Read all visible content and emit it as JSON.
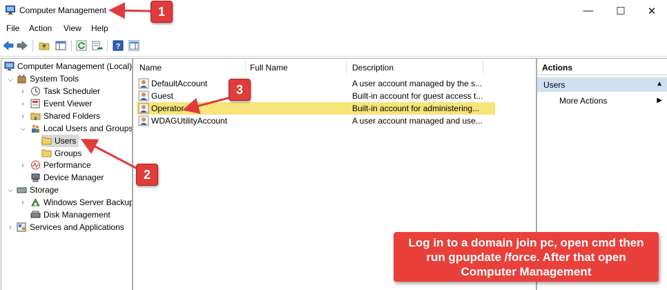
{
  "window": {
    "title": "Computer Management",
    "controls": [
      "—",
      "☐",
      "✕"
    ]
  },
  "menu": [
    "File",
    "Action",
    "View",
    "Help"
  ],
  "tree": {
    "root": "Computer Management (Local)",
    "system_tools": "System Tools",
    "task_scheduler": "Task Scheduler",
    "event_viewer": "Event Viewer",
    "shared_folders": "Shared Folders",
    "local_users_groups": "Local Users and Groups",
    "users": "Users",
    "groups": "Groups",
    "performance": "Performance",
    "device_manager": "Device Manager",
    "storage": "Storage",
    "windows_server_backup": "Windows Server Backup",
    "disk_management": "Disk Management",
    "services_apps": "Services and Applications"
  },
  "list": {
    "columns": [
      "Name",
      "Full Name",
      "Description"
    ],
    "rows": [
      {
        "name": "DefaultAccount",
        "full_name": "",
        "description": "A user account managed by the s..."
      },
      {
        "name": "Guest",
        "full_name": "",
        "description": "Built-in account for guest access t..."
      },
      {
        "name": "Operator",
        "full_name": "",
        "description": "Built-in account for administering..."
      },
      {
        "name": "WDAGUtilityAccount",
        "full_name": "",
        "description": "A user account managed and use..."
      }
    ],
    "selected_row": 2
  },
  "actions": {
    "header": "Actions",
    "section": "Users",
    "more": "More Actions"
  },
  "annotations": {
    "badge1": "1",
    "badge2": "2",
    "badge3": "3",
    "note": "Log in to a domain join pc, open cmd then run gpupdate /force. After that open Computer Management"
  },
  "colors": {
    "badge_red": "#e03c3c",
    "selection_yellow": "#f7e47a",
    "actions_section": "#cfe0f1"
  }
}
